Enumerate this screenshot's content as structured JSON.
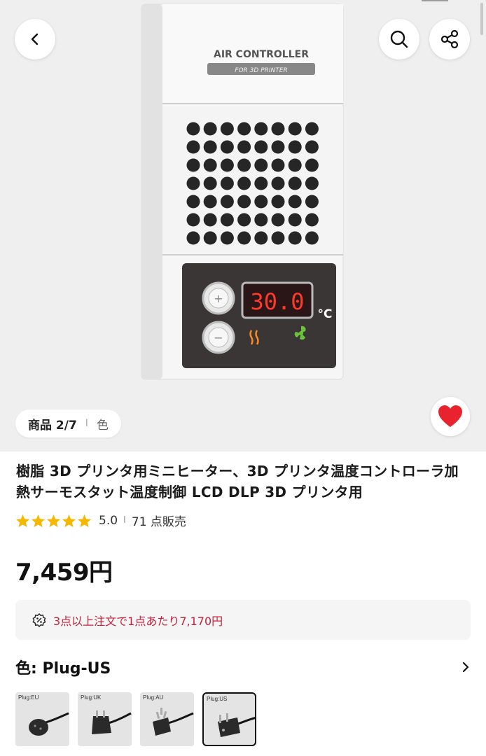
{
  "header": {
    "back_icon": "chevron-left-icon",
    "search_icon": "search-icon",
    "share_icon": "share-icon"
  },
  "product_image": {
    "brand_line1": "AIR CONTROLLER",
    "brand_line2": "FOR 3D PRINTER",
    "display_value": "30.0",
    "display_unit": "°C",
    "plus_sign": "+",
    "minus_sign": "−"
  },
  "gallery": {
    "counter": "商品 2/7",
    "separator": "I",
    "variant_label": "色"
  },
  "product": {
    "title": "樹脂 3D プリンタ用ミニヒーター、3D プリンタ温度コントローラ加熱サーモスタット温度制御 LCD DLP 3D プリンタ用",
    "rating": "5.0",
    "rating_separator": "I",
    "sold": "71 点販売",
    "price": "7,459円",
    "promo_text": "3点以上注文で1点あたり7,170円",
    "favorite_color": "#e8232e",
    "star_color": "#f5b800"
  },
  "variant": {
    "label": "色: Plug-US",
    "chevron_icon": "chevron-right-icon",
    "options": [
      {
        "label": "Plug:EU",
        "selected": false
      },
      {
        "label": "Plug:UK",
        "selected": false
      },
      {
        "label": "Plug:AU",
        "selected": false
      },
      {
        "label": "Plug:US",
        "selected": true
      }
    ]
  }
}
